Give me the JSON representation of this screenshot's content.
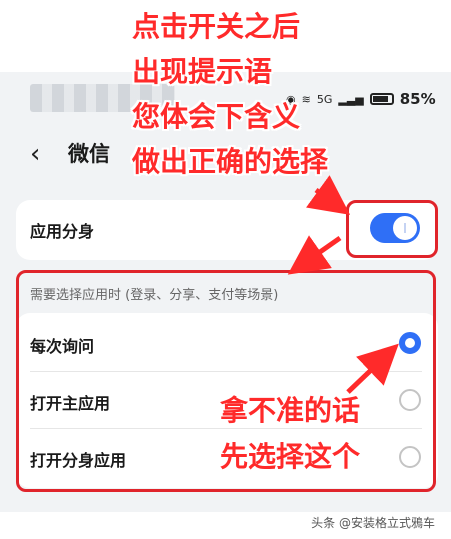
{
  "status_bar": {
    "signal_label": "5G",
    "battery_percent": "85%"
  },
  "header": {
    "back_icon": "chevron-left-icon",
    "title": "微信"
  },
  "app_clone": {
    "label": "应用分身",
    "toggle_on": true
  },
  "open_options": {
    "header": "需要选择应用时 (登录、分享、支付等场景)",
    "items": [
      {
        "label": "每次询问",
        "selected": true
      },
      {
        "label": "打开主应用",
        "selected": false
      },
      {
        "label": "打开分身应用",
        "selected": false
      }
    ]
  },
  "annotations": {
    "top_lines": [
      "点击开关之后",
      "出现提示语",
      "您体会下含义",
      "做出正确的选择"
    ],
    "bottom_lines": [
      "拿不准的话",
      "先选择这个"
    ],
    "color": "#ff2a2a"
  },
  "colors": {
    "accent": "#2f6ff6",
    "highlight_box": "#e0242b"
  },
  "watermark": "头条 @安装格立式鴉车"
}
